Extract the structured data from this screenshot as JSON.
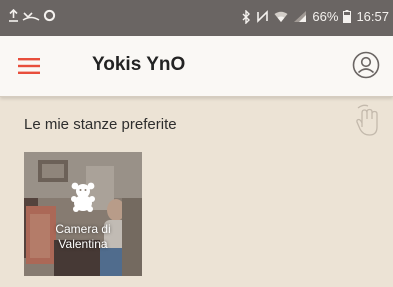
{
  "status_bar": {
    "battery": "66%",
    "time": "16:57"
  },
  "app_bar": {
    "title": "Yokis YnO"
  },
  "favorites": {
    "section_title": "Le mie stanze preferite",
    "rooms": [
      {
        "line1": "Camera di",
        "line2": "Valentina"
      }
    ]
  },
  "colors": {
    "accent": "#e84e3c",
    "status_bar": "#6a6563",
    "background": "#ece3d5"
  }
}
